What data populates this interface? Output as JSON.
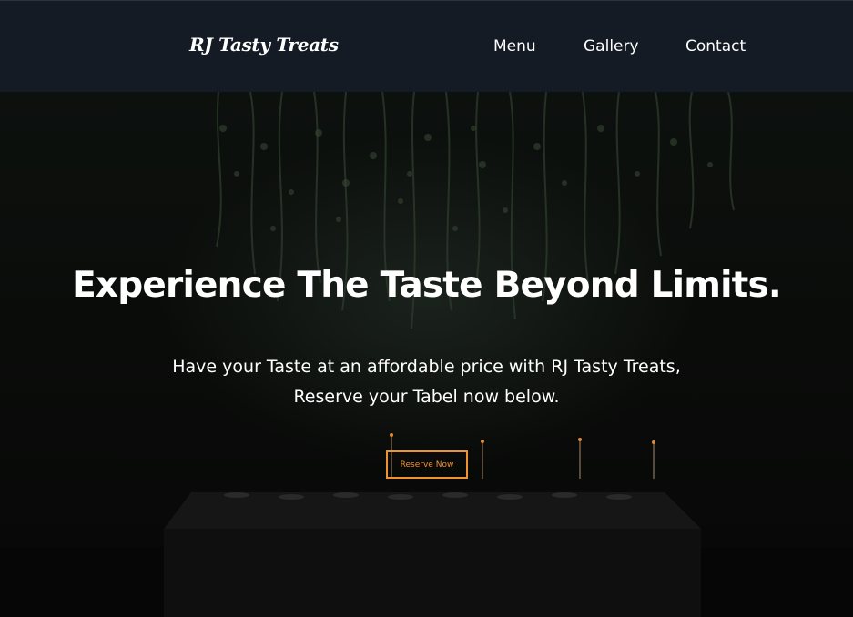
{
  "header": {
    "brand": "RJ Tasty Treats",
    "nav": [
      {
        "label": "Menu"
      },
      {
        "label": "Gallery"
      },
      {
        "label": "Contact"
      }
    ]
  },
  "hero": {
    "title": "Experience The Taste Beyond Limits.",
    "subtitle_line1": "Have your Taste at an affordable price with RJ Tasty Treats,",
    "subtitle_line2": "Reserve your Tabel now below.",
    "cta_label": "Reserve Now"
  },
  "colors": {
    "nav_background": "#141b24",
    "accent": "#f0922e",
    "text": "#ffffff"
  }
}
